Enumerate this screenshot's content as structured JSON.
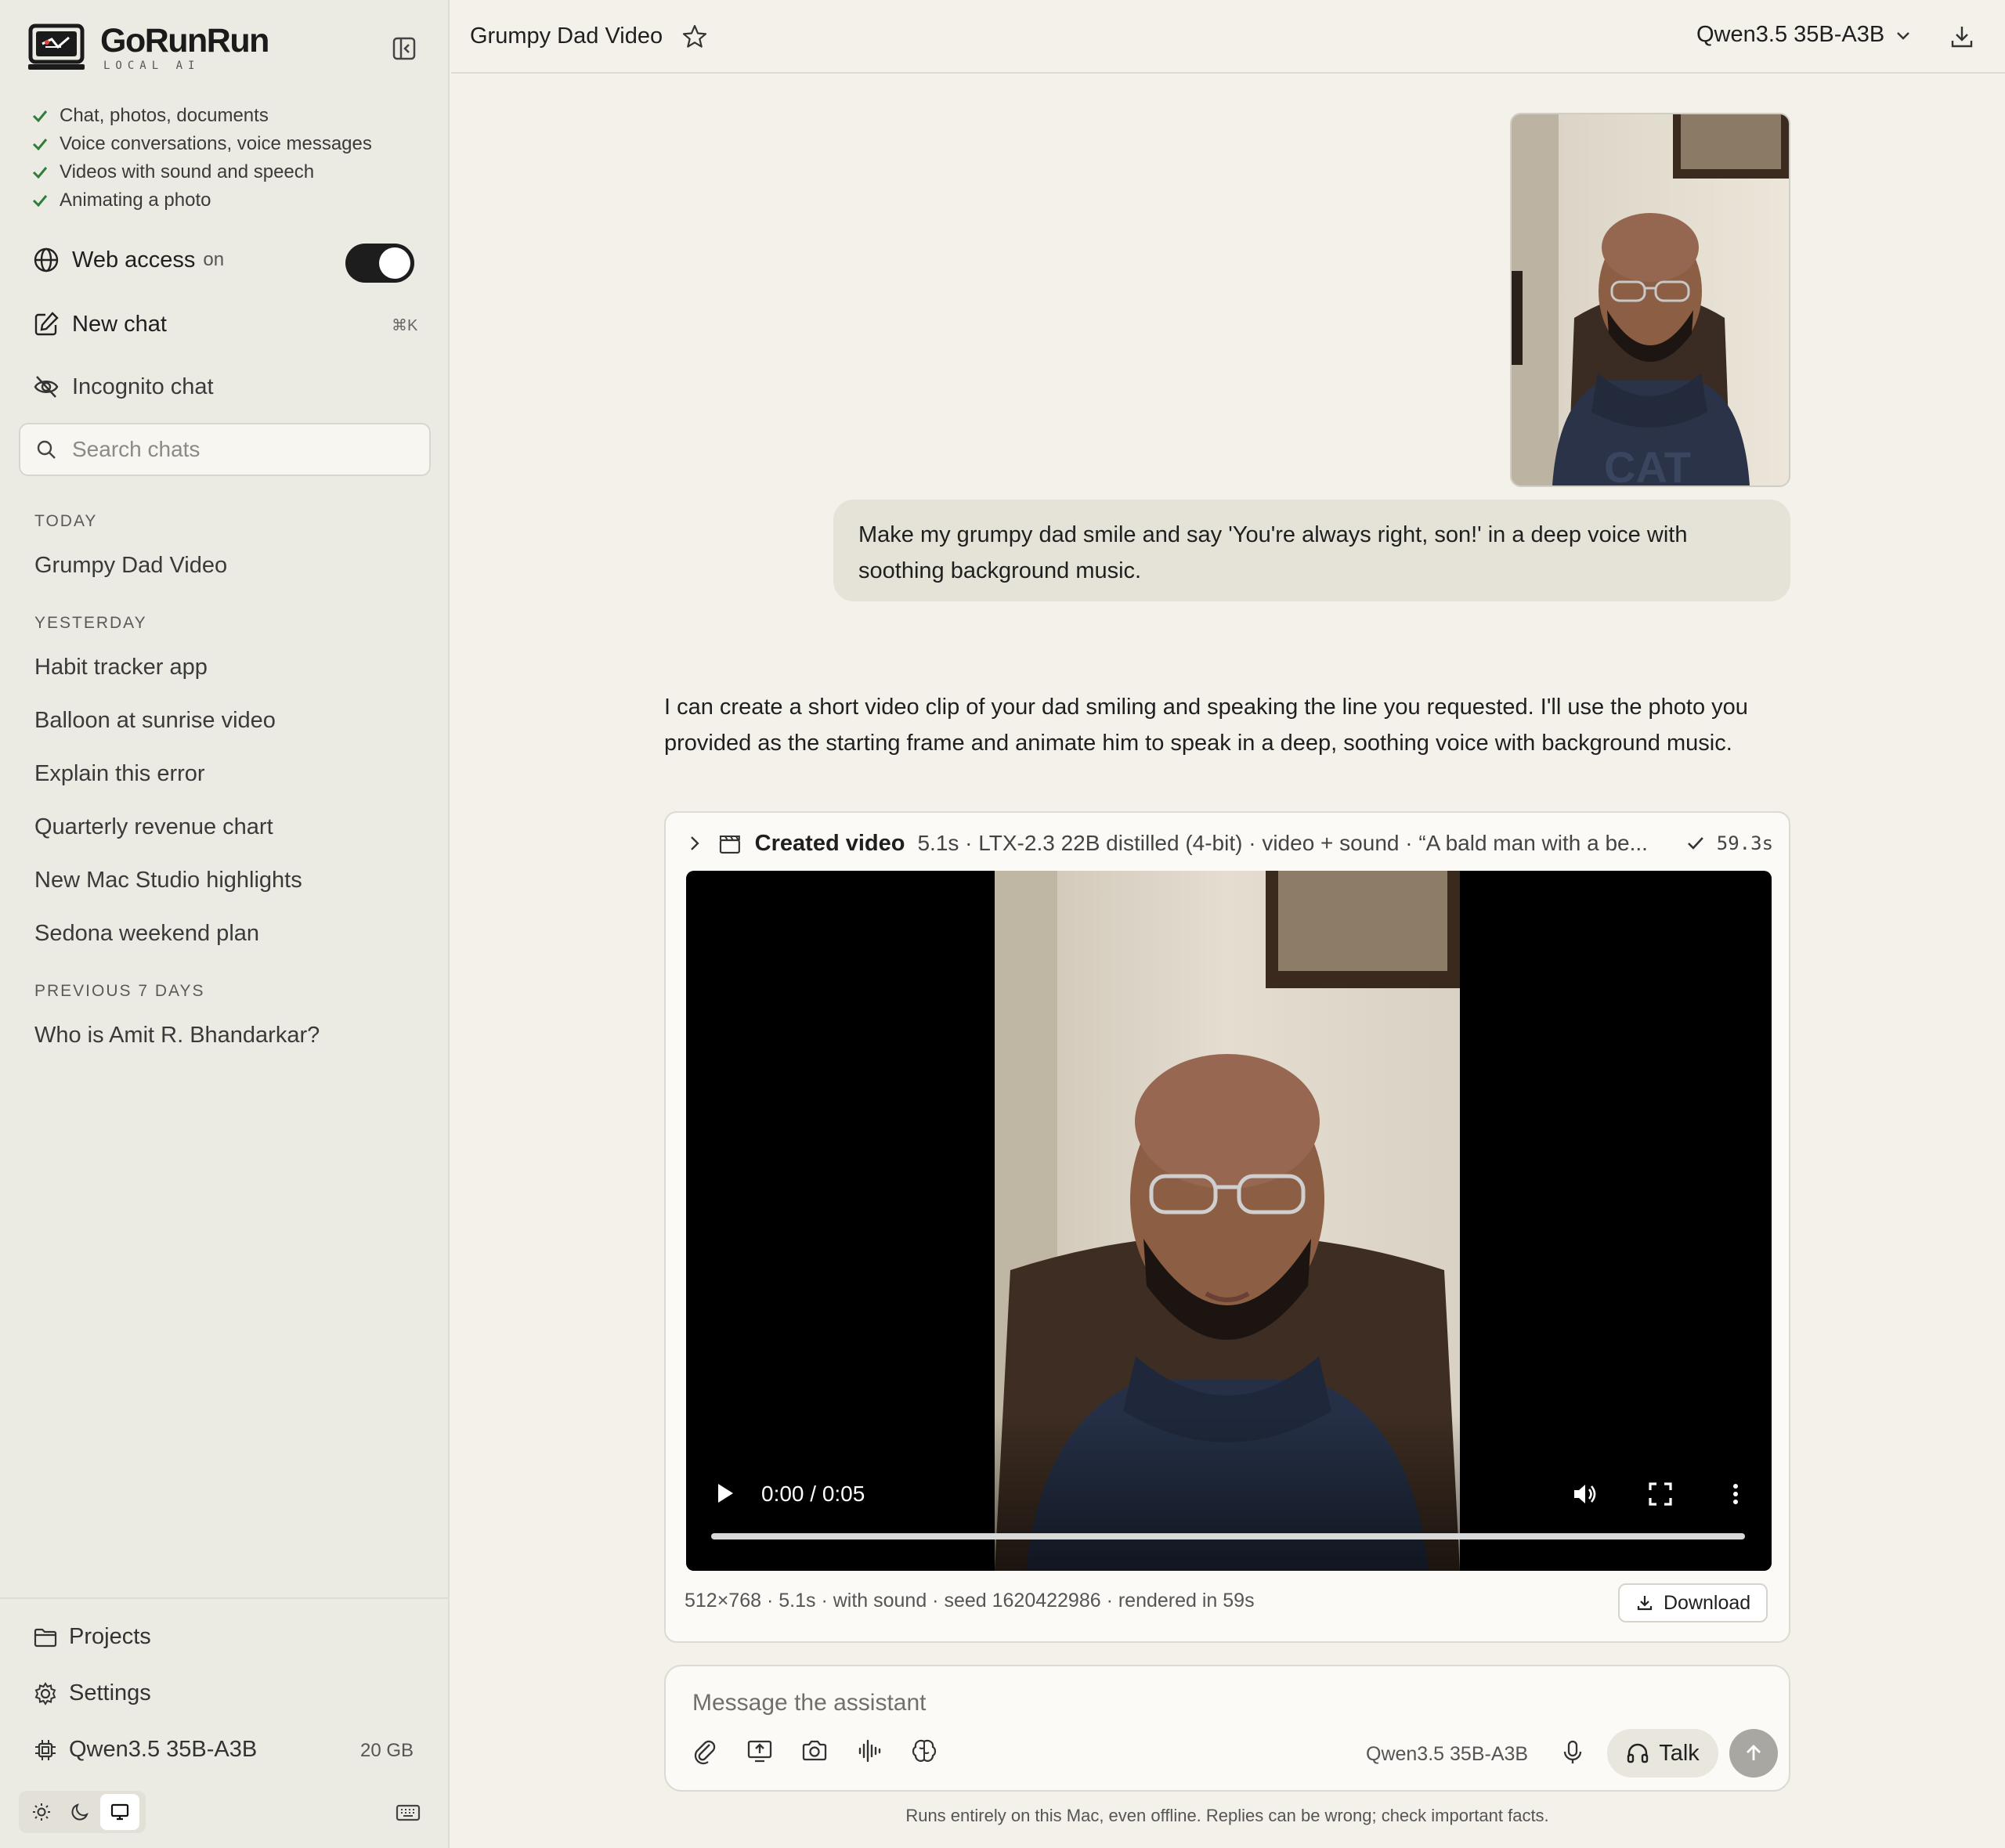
{
  "app": {
    "name": "GoRunRun",
    "tagline": "LOCAL AI"
  },
  "features": [
    "Chat, photos, documents",
    "Voice conversations, voice messages",
    "Videos with sound and speech",
    "Animating a photo"
  ],
  "sidebar": {
    "web_access_label": "Web access",
    "web_access_state": "on",
    "new_chat_label": "New chat",
    "new_chat_shortcut": "⌘K",
    "incognito_label": "Incognito chat",
    "search_placeholder": "Search chats",
    "groups": [
      {
        "label": "TODAY",
        "items": [
          "Grumpy Dad Video"
        ]
      },
      {
        "label": "YESTERDAY",
        "items": [
          "Habit tracker app",
          "Balloon at sunrise video",
          "Explain this error",
          "Quarterly revenue chart",
          "New Mac Studio highlights",
          "Sedona weekend plan"
        ]
      },
      {
        "label": "PREVIOUS 7 DAYS",
        "items": [
          "Who is Amit R. Bhandarkar?"
        ]
      }
    ],
    "footer": {
      "projects_label": "Projects",
      "settings_label": "Settings",
      "model_label": "Qwen3.5 35B-A3B",
      "model_size": "20 GB"
    },
    "theme_active": "system"
  },
  "header": {
    "chat_title": "Grumpy Dad Video",
    "model": "Qwen3.5 35B-A3B"
  },
  "messages": {
    "user_text": "Make my grumpy dad smile and say 'You're always right, son!' in a deep voice with soothing background music.",
    "assistant_text": "I can create a short video clip of your dad smiling and speaking the line you requested. I'll use the photo you provided as the starting frame and animate him to speak in a deep, soothing voice with background music."
  },
  "tool": {
    "name": "Created video",
    "meta": "5.1s · LTX-2.3 22B distilled (4-bit) · video + sound · “A bald man with a be...",
    "time": "59.3s",
    "player_time": "0:00 / 0:05",
    "progress": 0,
    "info": "512×768 · 5.1s · with sound · seed 1620422986 · rendered in 59s",
    "download_label": "Download"
  },
  "composer": {
    "placeholder": "Message the assistant",
    "model": "Qwen3.5 35B-A3B",
    "talk_label": "Talk"
  },
  "disclaimer": "Runs entirely on this Mac, even offline. Replies can be wrong; check important facts.",
  "colors": {
    "background": "#f3f1ea",
    "sidebar": "#ecebe3",
    "check_green": "#2f7d3a",
    "toggle_on": "#1d1d1d"
  }
}
